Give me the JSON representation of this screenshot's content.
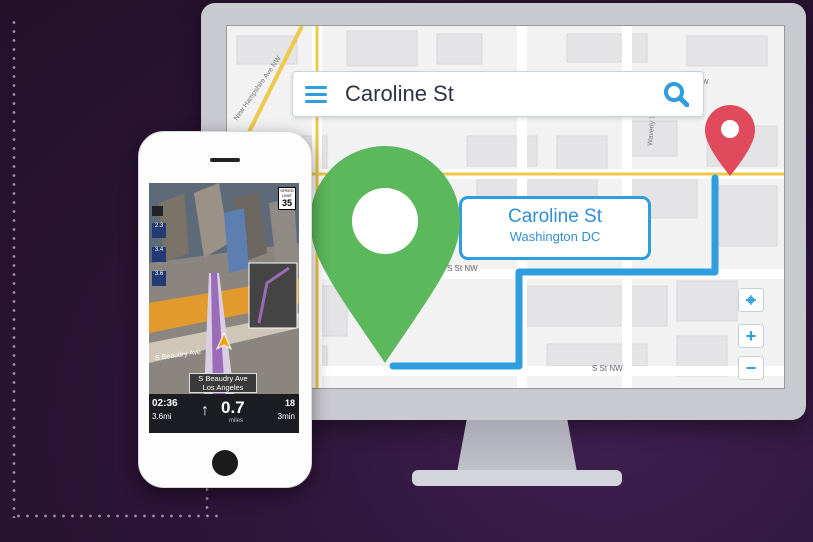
{
  "search": {
    "query": "Caroline St"
  },
  "map": {
    "callout_title": "Caroline St",
    "callout_subtitle": "Washington DC",
    "street_labels": [
      "S St NW",
      "S St NW",
      "New Hampshire Ave NW",
      "Waverly Te",
      "NW"
    ],
    "controls": {
      "locate": "⌖",
      "zoom_in": "+",
      "zoom_out": "−"
    }
  },
  "phone": {
    "speed_limit_label": "SPEED LIMIT",
    "speed_limit": "35",
    "lanes": [
      "2.3",
      "3.4",
      "3.6"
    ],
    "street_overlay": "S Beaudry Ave",
    "street_sign_line1": "S Beaudry Ave",
    "street_sign_line2": "Los Angeles",
    "eta_time": "02:36",
    "remaining_distance": "3.6mi",
    "turn_distance": "0.7",
    "turn_units": "miles",
    "right_top": "18",
    "right_bottom": "3min"
  },
  "colors": {
    "accent": "#2f9ee0",
    "start_pin": "#5cb85c",
    "end_pin": "#e04a5c",
    "background": "#2d1539"
  }
}
